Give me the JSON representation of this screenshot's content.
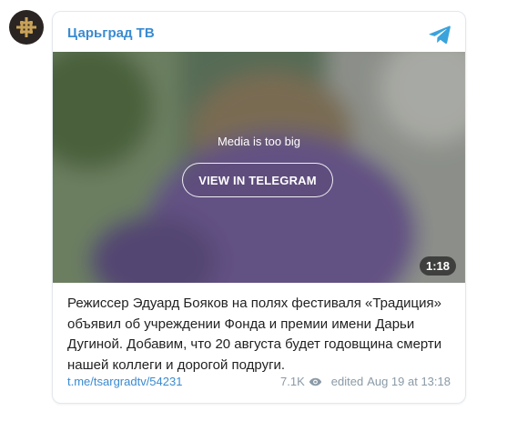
{
  "channel": {
    "name": "Царьград ТВ"
  },
  "media": {
    "notice": "Media is too big",
    "button_label": "VIEW IN TELEGRAM",
    "duration": "1:18"
  },
  "post": {
    "text": "Режиссер Эдуард Бояков на полях фестиваля «Традиция» объявил об учреждении Фонда и премии имени Дарьи Дугиной. Добавим, что 20 августа будет годовщина смерти нашей коллеги и дорогой подруги.",
    "link": "t.me/tsargradtv/54231",
    "views": "7.1K",
    "edited_label": "edited",
    "timestamp": "Aug 19 at 13:18"
  },
  "icons": {
    "avatar": "cross-emblem-icon",
    "brand": "telegram-icon",
    "views": "eye-icon"
  },
  "colors": {
    "link": "#3a8bd1",
    "meta": "#8a9aa6",
    "text": "#222222",
    "telegram": "#3aa3dc"
  }
}
